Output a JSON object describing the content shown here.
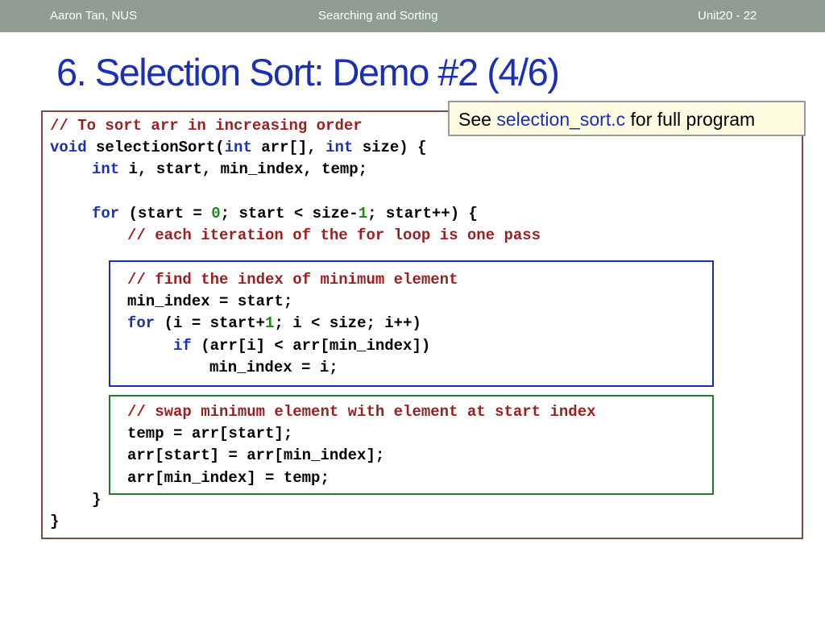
{
  "header": {
    "author": "Aaron Tan, NUS",
    "topic": "Searching and Sorting",
    "unit": "Unit20 - 22"
  },
  "title": "6. Selection Sort: Demo #2 (4/6)",
  "note": {
    "prefix": "See ",
    "link": "selection_sort.c",
    "suffix": " for full program"
  },
  "code": {
    "l1_comment": "// To sort arr in increasing order",
    "l2_kw": "void",
    "l2_rest1": " selectionSort(",
    "l2_int1": "int",
    "l2_rest2": " arr[], ",
    "l2_int2": "int",
    "l2_rest3": " size) {",
    "l3_int": "int",
    "l3_rest": " i, start, min_index, temp;",
    "l5_for": "for",
    "l5_a": " (start = ",
    "l5_zero": "0",
    "l5_b": "; start < size-",
    "l5_one": "1",
    "l5_c": "; start++) {",
    "l6_comment": "// each iteration of the for loop is one pass",
    "l8_comment": "// find the index of minimum element",
    "l9": "min_index = start;",
    "l10_for": "for",
    "l10_a": " (i = start+",
    "l10_one": "1",
    "l10_b": "; i < size; i++)",
    "l11_if": "if",
    "l11_rest": " (arr[i] < arr[min_index])",
    "l12": "min_index = i;",
    "l14_comment": "// swap minimum element with element at start index",
    "l15": "temp = arr[start];",
    "l16": "arr[start] = arr[min_index];",
    "l17": "arr[min_index] = temp;",
    "l18": "}",
    "l19": "}"
  }
}
